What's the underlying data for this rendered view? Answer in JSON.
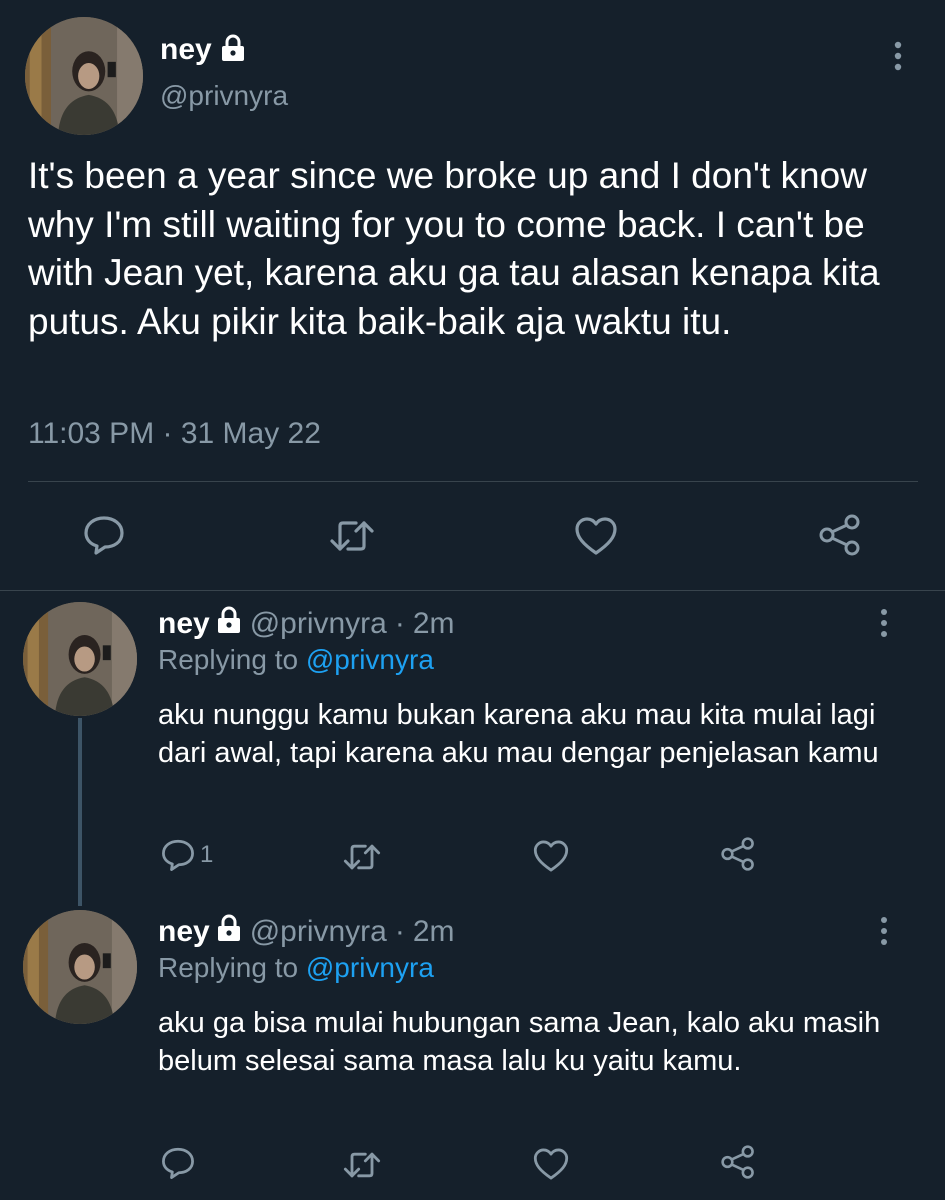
{
  "colors": {
    "background": "#15202b",
    "text": "#ffffff",
    "secondary_text": "#8899a6",
    "link": "#1da1f2",
    "divider": "#38444d"
  },
  "main_tweet": {
    "avatar_icon": "avatar",
    "name": "ney",
    "protected_icon": "lock-icon",
    "handle": "@privnyra",
    "text": "It's been a year since we broke up and I don't know why I'm still waiting for you to come back. I can't be with Jean yet, karena aku ga tau alasan kenapa kita putus. Aku pikir kita baik-baik aja waktu itu.",
    "timestamp": "11:03 PM · 31 May 22",
    "actions": {
      "reply_icon": "reply-icon",
      "retweet_icon": "retweet-icon",
      "like_icon": "heart-icon",
      "share_icon": "share-icon"
    }
  },
  "replies": [
    {
      "name": "ney",
      "handle": "@privnyra",
      "separator": "·",
      "time": "2m",
      "replying_prefix": "Replying to",
      "replying_to": "@privnyra",
      "text": "aku nunggu kamu bukan karena aku mau kita mulai lagi dari awal, tapi karena aku mau dengar penjelasan kamu",
      "reply_count": "1"
    },
    {
      "name": "ney",
      "handle": "@privnyra",
      "separator": "·",
      "time": "2m",
      "replying_prefix": "Replying to",
      "replying_to": "@privnyra",
      "text": "aku ga bisa mulai hubungan sama Jean, kalo aku masih belum selesai sama masa lalu ku yaitu kamu.",
      "reply_count": ""
    }
  ]
}
